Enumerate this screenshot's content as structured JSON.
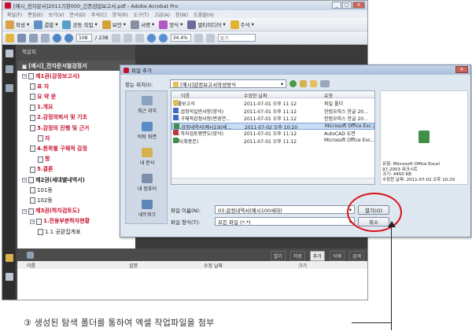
{
  "app": {
    "title": "[예시_전자문서]2011기항000_긴종검업보고서.pdf - Adobe Acrobat Pro",
    "menu": [
      "파일(F)",
      "편집(E)",
      "보기(V)",
      "문서(D)",
      "주석(C)",
      "양식(R)",
      "도구(T)",
      "고급(A)",
      "창(W)",
      "도움말(H)"
    ],
    "toolbar1": [
      {
        "label": "작성",
        "icon": "create-icon",
        "color": "#d7a24a"
      },
      {
        "label": "결합",
        "icon": "combine-icon",
        "color": "#5f8fc7"
      },
      {
        "label": "공동 작업",
        "icon": "collaborate-icon",
        "color": "#58a2c8"
      },
      {
        "label": "보안",
        "icon": "lock-icon",
        "color": "#d1a23b"
      },
      {
        "label": "서명",
        "icon": "sign-icon",
        "color": "#8790a0"
      },
      {
        "label": "양식",
        "icon": "forms-icon",
        "color": "#b35ac2"
      },
      {
        "label": "멀티미디어",
        "icon": "multimedia-icon",
        "color": "#6c6c9a"
      },
      {
        "label": "주석",
        "icon": "comment-icon",
        "color": "#e0b430"
      }
    ],
    "page_current": "108",
    "page_total": "/ 238",
    "zoom": "34.4%",
    "search_placeholder": "찾기"
  },
  "navpanel": {
    "header": "책갈피",
    "root": "[예시]_전자문서철검정서",
    "items": [
      {
        "label": "제1권(감정보고서)",
        "style": "red bold",
        "depth": 1,
        "toggle": "−"
      },
      {
        "label": "표 자",
        "style": "red bold",
        "depth": 2
      },
      {
        "label": "요 약 문",
        "style": "red bold",
        "depth": 2
      },
      {
        "label": "1.개요",
        "style": "red bold",
        "depth": 2
      },
      {
        "label": "2.감정의뢰서 및 기초",
        "style": "red bold",
        "depth": 2
      },
      {
        "label": "3.감정의 진행 및 근거",
        "style": "red bold",
        "depth": 2
      },
      {
        "label": "자",
        "style": "red bold",
        "depth": 3
      },
      {
        "label": "4.원목별 구체적 감정",
        "style": "red bold",
        "depth": 2
      },
      {
        "label": "항",
        "style": "red bold",
        "depth": 3
      },
      {
        "label": "5.결론",
        "style": "red bold",
        "depth": 2
      },
      {
        "label": "제2권(세대별내역서)",
        "style": "dark bold",
        "depth": 1,
        "toggle": "−"
      },
      {
        "label": "101동",
        "style": "dark",
        "depth": 2
      },
      {
        "label": "102동",
        "style": "dark",
        "depth": 2
      },
      {
        "label": "제3권(하자검토도)",
        "style": "red bold",
        "depth": 1,
        "toggle": "−"
      },
      {
        "label": "1.전용부분하자현황",
        "style": "red bold",
        "depth": 2,
        "toggle": "−"
      },
      {
        "label": "1.1 공환집계표",
        "style": "dark",
        "depth": 3
      }
    ]
  },
  "attachments": {
    "actions": [
      {
        "label": "열기",
        "active": false
      },
      {
        "label": "저장",
        "active": false
      },
      {
        "label": "추가",
        "active": true
      },
      {
        "label": "삭제",
        "active": false
      },
      {
        "label": "검색",
        "active": false
      }
    ],
    "columns": [
      "이름",
      "설명",
      "수정 날짜",
      "크기"
    ]
  },
  "dialog": {
    "title": "파일 추가",
    "look_in_label": "찾는 위치(I):",
    "look_in_value": "[예시]감정보고서작성방식",
    "places": [
      "최근 위치",
      "바탕 화면",
      "내 문서",
      "내 컴퓨터",
      "네트워크"
    ],
    "columns": [
      "이름",
      "수정한 날짜",
      "유형"
    ],
    "files": [
      {
        "name": "법률보고서",
        "date": "2011-07-01 오후 11:12",
        "type": "파일 폴더",
        "color": "#e2c15a",
        "selected": false
      },
      {
        "name": "01.검정의일반사항(양식)",
        "date": "2011-07-01 오후 11:12",
        "type": "한컴오피스 한글 20...",
        "color": "#3d6cc2",
        "selected": false
      },
      {
        "name": "02.구체적감정사항(변경연...",
        "date": "2011-07-01 오후 11:12",
        "type": "한컴오피스 한글 20...",
        "color": "#3d6cc2",
        "selected": false
      },
      {
        "name": "03.감정내역서(예시100세...",
        "date": "2011-07-02 오후 10:20",
        "type": "Microsoft Office Exc...",
        "color": "#3f8f48",
        "selected": true
      },
      {
        "name": "04.하자검토평면도(양식)",
        "date": "2011-07-01 오후 11:12",
        "type": "AutoCAD 도면",
        "color": "#b83a3a",
        "selected": false
      },
      {
        "name": "표지(최종본)",
        "date": "2011-07-01 오후 11:12",
        "type": "Microsoft Office Exc...",
        "color": "#3f8f48",
        "selected": false
      }
    ],
    "preview": {
      "type": "유형: Microsoft Office Excel",
      "type_extra": "97-2003 워크시트",
      "size": "크기: 4450 KB",
      "modified": "수정한 날짜: 2011-07-02 오후 10:29"
    },
    "filename_label": "파일 이름(N):",
    "filename_value": "03.감정내역서(예시100세대)",
    "filetype_label": "파일 형식(T):",
    "filetype_value": "모든 파일 (*.*)",
    "open_button": "열기(O)",
    "cancel_button": "취소"
  },
  "caption": "③ 생성된 탐색 폴더를 통하여 엑셀 작업파일을 첨부",
  "colors": {
    "highlight": "#d9141b",
    "accent": "#c8102e"
  }
}
